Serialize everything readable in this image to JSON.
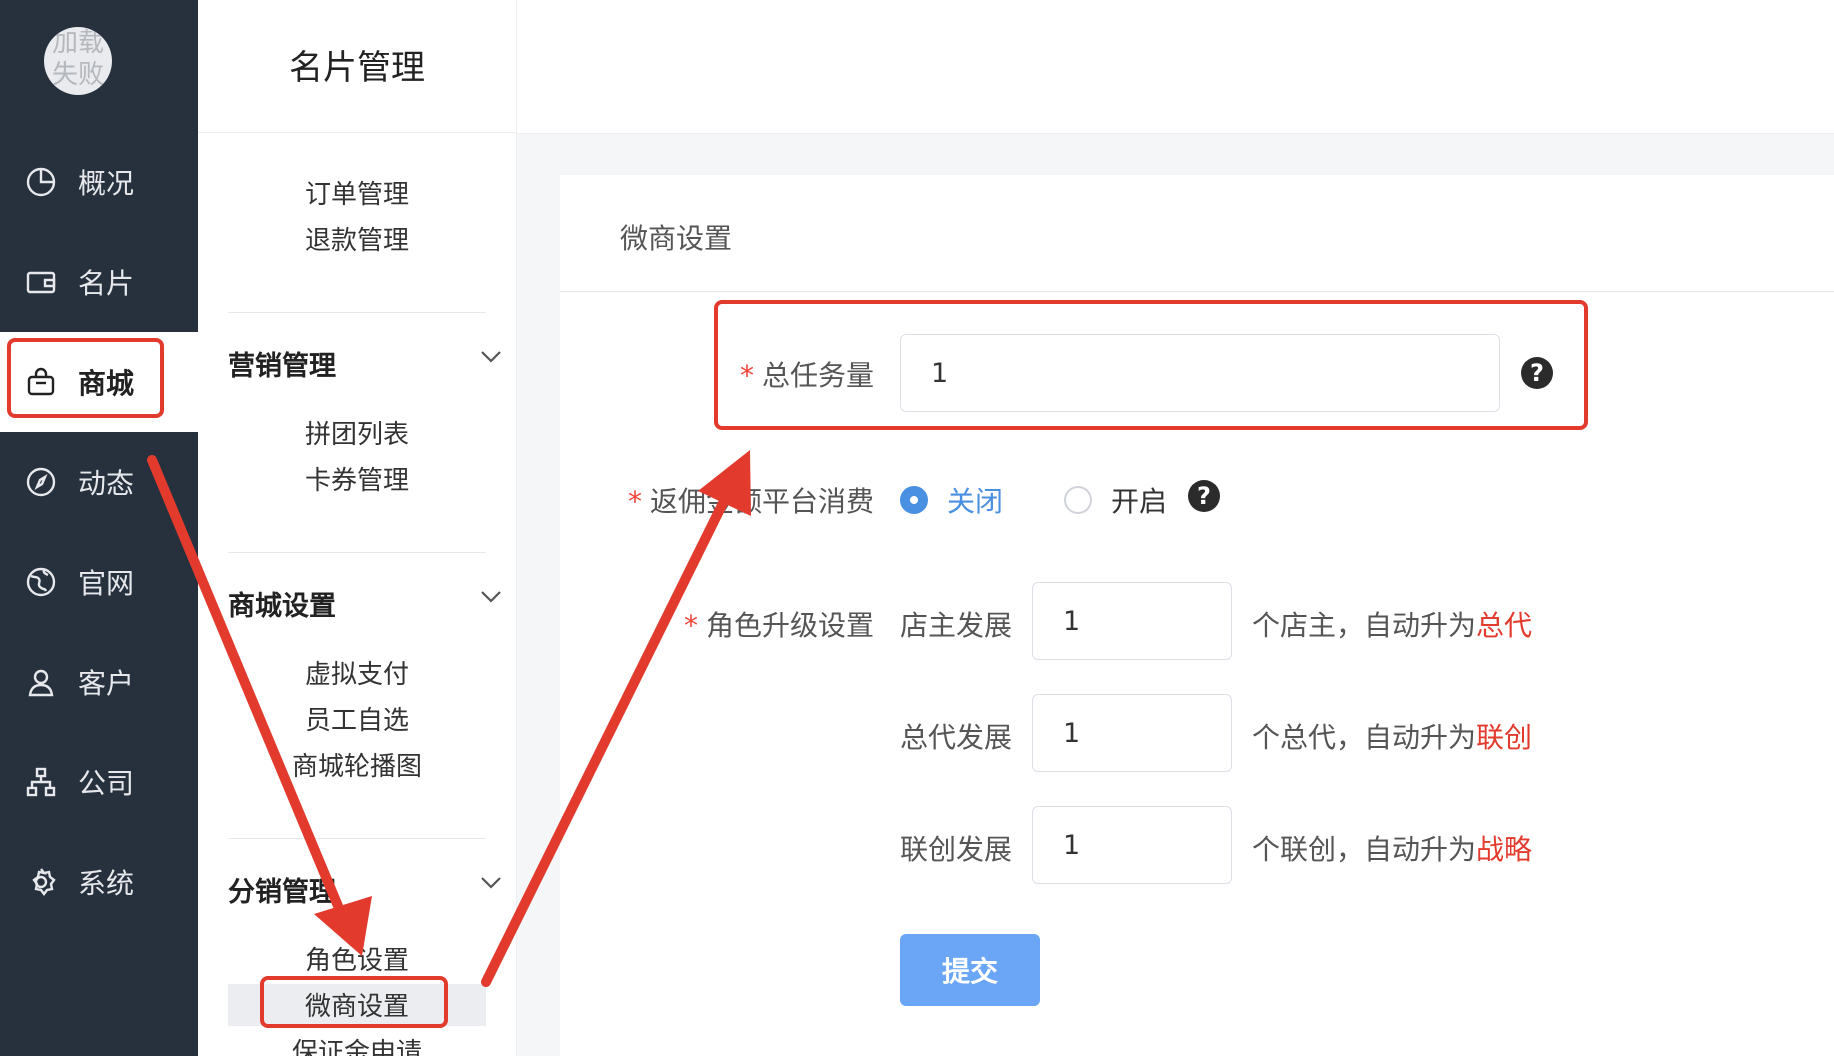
{
  "rail": {
    "avatar_text": "加载失败",
    "items": [
      {
        "label": "概况",
        "icon": "pie-chart-icon"
      },
      {
        "label": "名片",
        "icon": "wallet-icon"
      },
      {
        "label": "商城",
        "icon": "shopping-bag-icon"
      },
      {
        "label": "动态",
        "icon": "compass-icon"
      },
      {
        "label": "官网",
        "icon": "globe-icon"
      },
      {
        "label": "客户",
        "icon": "user-icon"
      },
      {
        "label": "公司",
        "icon": "org-chart-icon"
      },
      {
        "label": "系统",
        "icon": "gear-icon"
      }
    ],
    "active_index": 2
  },
  "sidebar": {
    "title": "名片管理",
    "top_items": [
      "订单管理",
      "退款管理"
    ],
    "sections": [
      {
        "title": "营销管理",
        "items": [
          "拼团列表",
          "卡券管理"
        ]
      },
      {
        "title": "商城设置",
        "items": [
          "虚拟支付",
          "员工自选",
          "商城轮播图"
        ]
      },
      {
        "title": "分销管理",
        "items": [
          "角色设置",
          "微商设置",
          "保证金申请"
        ]
      }
    ],
    "selected": "微商设置"
  },
  "form": {
    "card_title": "微商设置",
    "total_tasks": {
      "label": "总任务量",
      "value": "1"
    },
    "rebate": {
      "label": "返佣金额平台消费",
      "options": [
        "关闭",
        "开启"
      ],
      "selected": "关闭"
    },
    "role_upgrade": {
      "label": "角色升级设置",
      "rows": [
        {
          "label": "店主发展",
          "value": "1",
          "suffix": "个店主，自动升为",
          "target": "总代"
        },
        {
          "label": "总代发展",
          "value": "1",
          "suffix": "个总代，自动升为",
          "target": "联创"
        },
        {
          "label": "联创发展",
          "value": "1",
          "suffix": "个联创，自动升为",
          "target": "战略"
        }
      ]
    },
    "submit_label": "提交",
    "required_mark": "*",
    "help_glyph": "?"
  },
  "colors": {
    "rail_bg": "#27303d",
    "highlight": "#e23b2d",
    "accent": "#4a90e2",
    "submit": "#6aa6f5"
  }
}
